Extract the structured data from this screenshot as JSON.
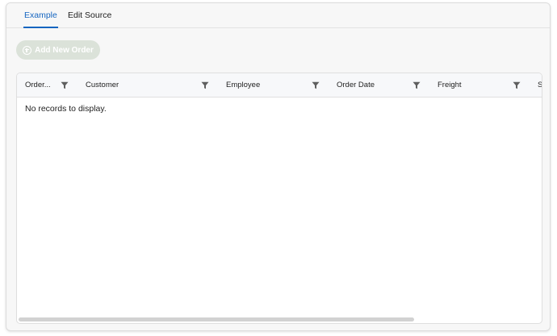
{
  "tabs": [
    {
      "label": "Example",
      "active": true
    },
    {
      "label": "Edit Source",
      "active": false
    }
  ],
  "toolbar": {
    "add_label": "Add New Order",
    "add_icon": "plus-circle-icon"
  },
  "grid": {
    "columns": [
      {
        "title": "Order..."
      },
      {
        "title": "Customer"
      },
      {
        "title": "Employee"
      },
      {
        "title": "Order Date"
      },
      {
        "title": "Freight"
      },
      {
        "title": "S"
      }
    ],
    "filter_icon": "filter-icon",
    "empty_message": "No records to display."
  },
  "colors": {
    "accent": "#1565c0",
    "button_disabled": "#dbe2d9",
    "header_bg": "#f7f8fa"
  }
}
